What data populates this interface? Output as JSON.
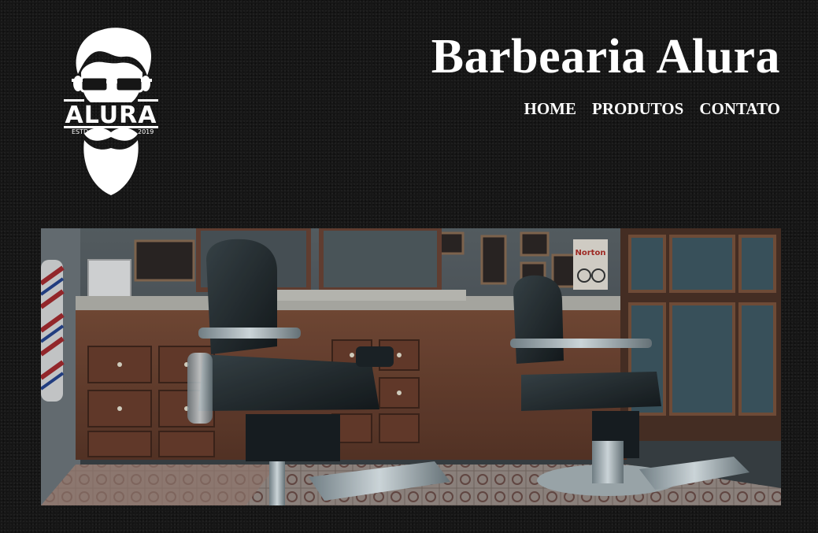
{
  "header": {
    "site_title": "Barbearia Alura",
    "logo": {
      "brand_text": "ALURA",
      "estd_text": "ESTD",
      "year_text": "2019",
      "icon": "bearded-man-logo-icon"
    }
  },
  "nav": {
    "items": [
      {
        "label": "HOME"
      },
      {
        "label": "PRODUTOS"
      },
      {
        "label": "CONTATO"
      }
    ]
  },
  "banner": {
    "description_icon": "barbershop-interior-image",
    "sign_text": "Norton"
  },
  "colors": {
    "background": "#161616",
    "text": "#ffffff"
  }
}
